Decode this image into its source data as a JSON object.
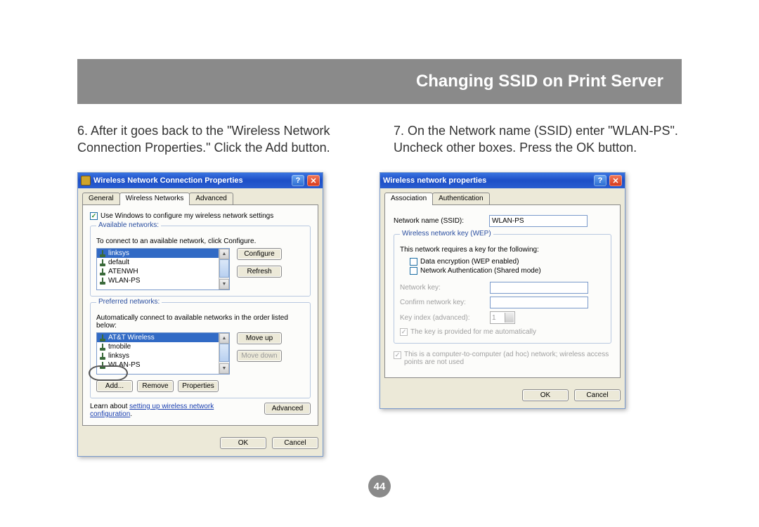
{
  "header": {
    "title": "Changing SSID on Print Server"
  },
  "steps": {
    "s6": "6. After it goes back to the \"Wireless Network Connection Properties.\" Click  the Add button.",
    "s7": "7. On the Network name (SSID) enter \"WLAN-PS\". Uncheck other boxes. Press the OK button."
  },
  "dlg1": {
    "title": "Wireless Network Connection Properties",
    "tabs": {
      "general": "General",
      "wireless": "Wireless Networks",
      "advanced": "Advanced"
    },
    "use_windows": "Use Windows to configure my wireless network settings",
    "available": {
      "legend": "Available networks:",
      "hint": "To connect to an available network, click Configure.",
      "items": [
        "linksys",
        "default",
        "ATENWH",
        "WLAN-PS"
      ],
      "configure": "Configure",
      "refresh": "Refresh"
    },
    "preferred": {
      "legend": "Preferred networks:",
      "hint": "Automatically connect to available networks in the order listed below:",
      "items": [
        "AT&T Wireless",
        "tmobile",
        "linksys",
        "WLAN-PS"
      ],
      "moveup": "Move up",
      "movedown": "Move down",
      "add": "Add...",
      "remove": "Remove",
      "properties": "Properties"
    },
    "learn_prefix": "Learn about ",
    "learn_link": "setting up wireless network configuration",
    "advanced_btn": "Advanced",
    "ok": "OK",
    "cancel": "Cancel"
  },
  "dlg2": {
    "title": "Wireless network properties",
    "tabs": {
      "assoc": "Association",
      "auth": "Authentication"
    },
    "ssid_label": "Network name (SSID):",
    "ssid_value": "WLAN-PS",
    "wep": {
      "legend": "Wireless network key (WEP)",
      "hint": "This network requires a key for the following:",
      "data_enc": "Data encryption (WEP enabled)",
      "net_auth": "Network Authentication (Shared mode)",
      "netkey": "Network key:",
      "confirm": "Confirm network key:",
      "keyidx": "Key index (advanced):",
      "keyidx_val": "1",
      "auto_key": "The key is provided for me automatically"
    },
    "adhoc": "This is a computer-to-computer (ad hoc) network; wireless access points are not used",
    "ok": "OK",
    "cancel": "Cancel"
  },
  "page_number": "44"
}
